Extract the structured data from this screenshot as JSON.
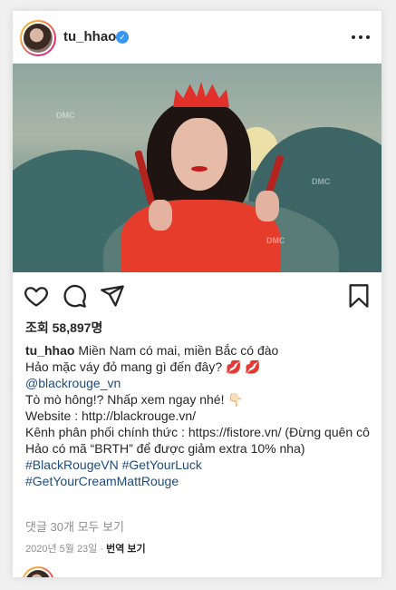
{
  "post": {
    "username": "tu_hhao",
    "verified_mark": "✓",
    "photo_watermark": "DMC",
    "views_label": "조회 58,897명",
    "caption": {
      "username": "tu_hhao",
      "line1": "Miền Nam có mai, miền Bắc có đào",
      "line2": "Hảo mặc váy đỏ mang gì đến đây? 💋 💋",
      "mention": "@blackrouge_vn",
      "line4": "Tò mò hông!? Nhấp xem ngay nhé! 👇🏻",
      "line5": "Website : http://blackrouge.vn/",
      "line6": "Kênh phân phối chính thức : https://fistore.vn/ (Đừng quên cô Hảo có mã “BRTH” để được giảm extra 10% nha)",
      "tags_line1": "#BlackRougeVN #GetYourLuck",
      "tags_line2": "#GetYourCreamMattRouge"
    },
    "comments_link": "댓글 30개 모두 보기",
    "date": "2020년 5월 23일",
    "separator": "·",
    "translate_label": "번역 보기"
  },
  "icons": {
    "more": "more-options-icon",
    "like": "heart-icon",
    "comment": "comment-icon",
    "share": "send-icon",
    "save": "bookmark-icon"
  },
  "colors": {
    "link": "#1f4b7a",
    "verified": "#3897f0",
    "muted": "#8e8e8e",
    "text": "#262626"
  }
}
